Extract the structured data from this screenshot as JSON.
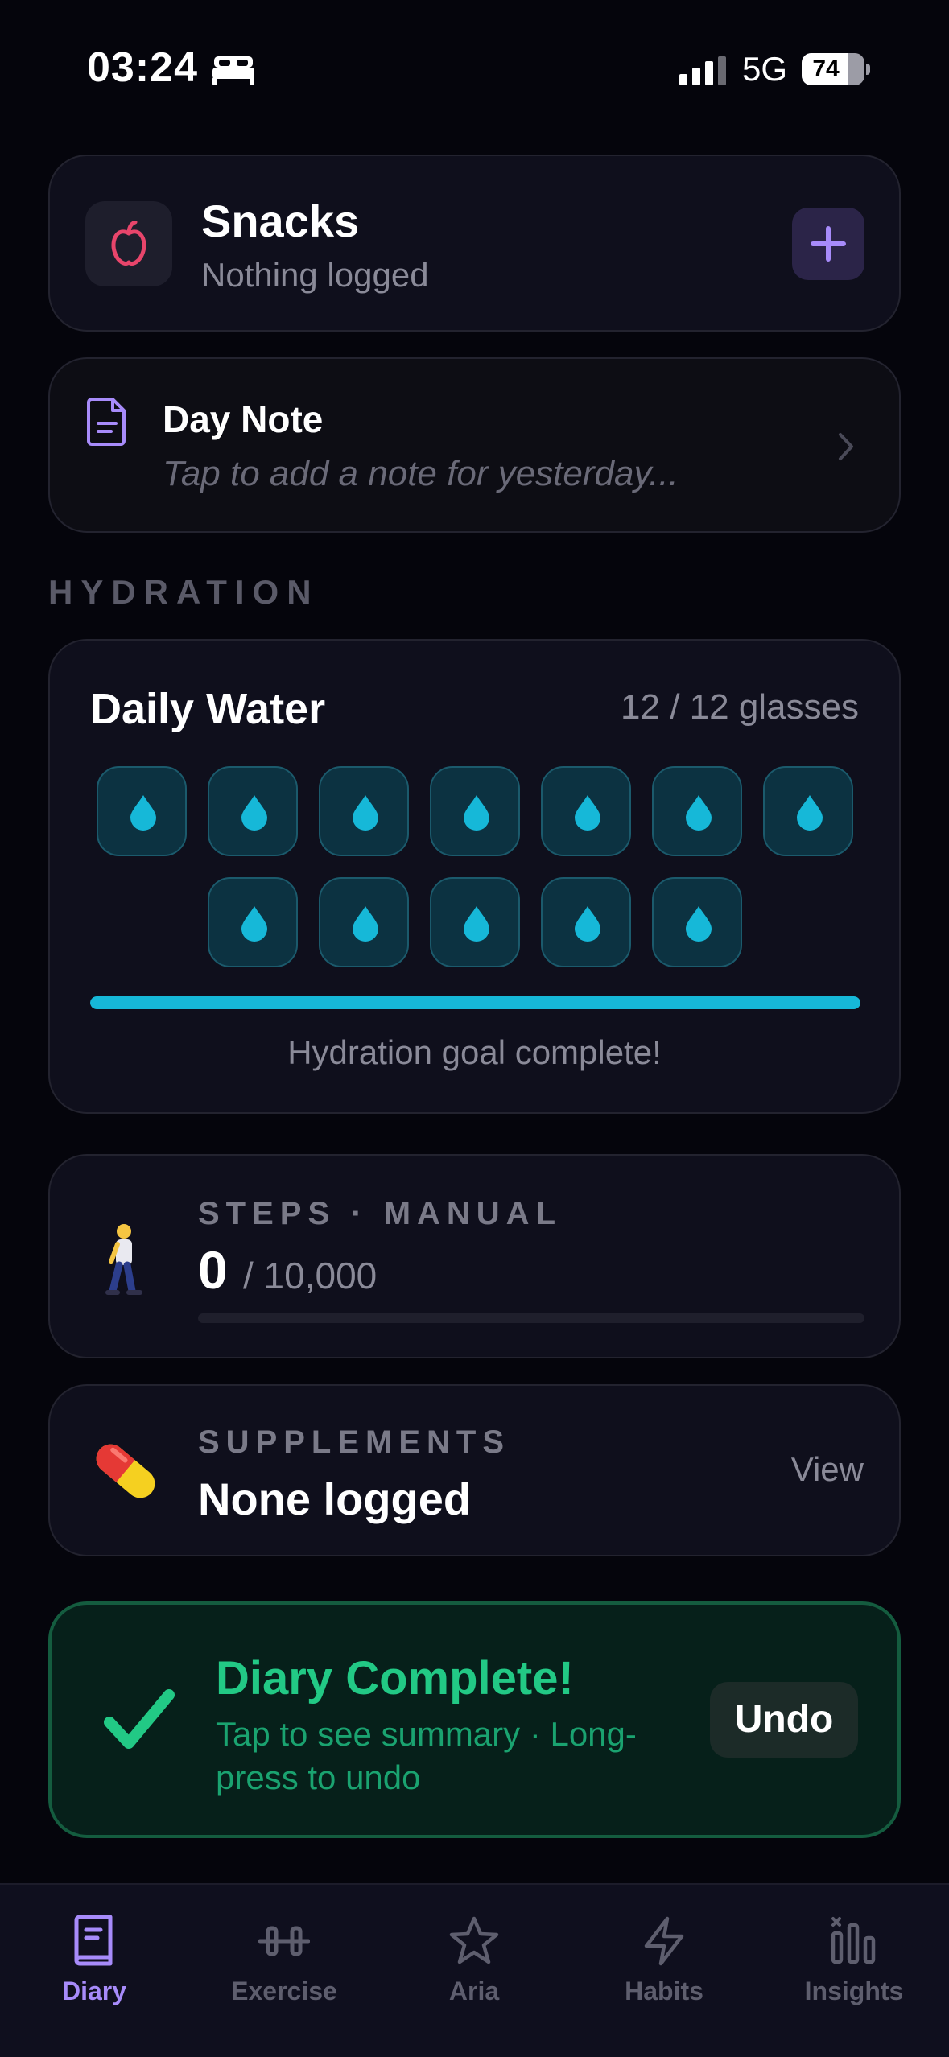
{
  "status_bar": {
    "time": "03:24",
    "network": "5G",
    "battery": "74",
    "battery_level": 0.74
  },
  "snacks": {
    "title": "Snacks",
    "subtitle": "Nothing logged",
    "icon": "apple-icon",
    "add_icon": "plus-icon",
    "accent": "#e8456b"
  },
  "day_note": {
    "title": "Day Note",
    "placeholder": "Tap to add a note for yesterday...",
    "icon": "note-icon"
  },
  "hydration": {
    "section_label": "HYDRATION",
    "title": "Daily Water",
    "count": "12 / 12 glasses",
    "glasses_filled": 12,
    "glasses_total": 12,
    "progress": 1.0,
    "status": "Hydration goal complete!",
    "accent": "#16b8d8"
  },
  "steps": {
    "label": "STEPS · MANUAL",
    "value": "0",
    "goal": "/ 10,000",
    "progress": 0,
    "icon": "person-walking-emoji"
  },
  "supplements": {
    "label": "SUPPLEMENTS",
    "value": "None logged",
    "action": "View",
    "icon": "pill-emoji"
  },
  "diary_complete": {
    "title": "Diary Complete!",
    "subtitle": "Tap to see summary · Long-press to undo",
    "undo_label": "Undo",
    "accent": "#22c985"
  },
  "tabs": [
    {
      "label": "Diary",
      "icon": "book-icon",
      "active": true
    },
    {
      "label": "Exercise",
      "icon": "dumbbell-icon",
      "active": false
    },
    {
      "label": "Aria",
      "icon": "star-icon",
      "active": false
    },
    {
      "label": "Habits",
      "icon": "lightning-icon",
      "active": false
    },
    {
      "label": "Insights",
      "icon": "bar-chart-icon",
      "active": false
    }
  ]
}
